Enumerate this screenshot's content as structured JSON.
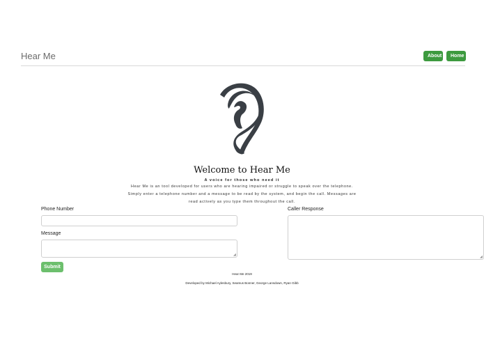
{
  "navbar": {
    "brand": "Hear Me",
    "about_label": "About",
    "home_label": "Home"
  },
  "hero": {
    "logo_icon": "ear-icon",
    "title": "Welcome to Hear Me",
    "tagline": "A voice for those who need it",
    "description": "Hear Me is an tool developed for users who are hearing impaired or struggle to speak over the telephone. Simply enter a telephone number and a message to be read by the system, and begin the call. Messages are read actively as you type them throughout the call."
  },
  "form": {
    "phone_label": "Phone Number",
    "phone_value": "",
    "message_label": "Message",
    "message_value": "",
    "submit_label": "Submit",
    "caller_label": "Caller Response",
    "caller_value": ""
  },
  "footer": {
    "year_text": "Hear Me 2019",
    "developers_text": "Developed by Michael Aylesbury, Seamus Bonner, George Lansdown, Ryan Gibb"
  },
  "colors": {
    "button_green": "#3d9a3f",
    "submit_green": "#6cbf6d",
    "logo_dark": "#3a3f45"
  }
}
